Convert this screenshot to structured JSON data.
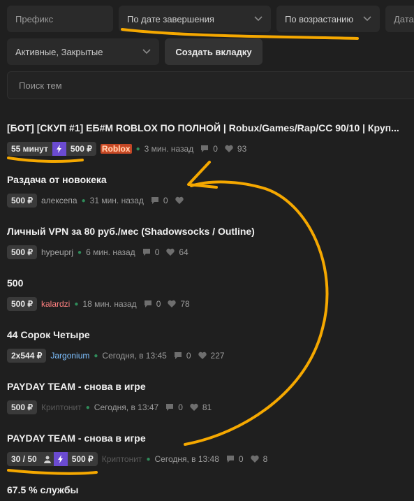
{
  "filters": {
    "prefix_placeholder": "Префикс",
    "sort_by": "По дате завершения",
    "sort_order": "По возрастанию",
    "date_partial": "Дата",
    "status": "Активные, Закрытые",
    "create_tab_label": "Создать вкладку"
  },
  "search": {
    "placeholder": "Поиск тем"
  },
  "threads": [
    {
      "title": "[БОТ] [СКУП #1] ЕБ#М ROBLOX ПО ПОЛНОЙ | Robux/Games/Rap/CC 90/10 | Круп...",
      "chip_time": "55 минут",
      "chip_price": "500 ₽",
      "author": "Roblox",
      "time": "3 мин. назад",
      "replies": "0",
      "likes": "93"
    },
    {
      "title": "Раздача от новокека",
      "chip_price": "500 ₽",
      "author": "алексепа",
      "time": "31 мин. назад",
      "replies": "0",
      "likes": ""
    },
    {
      "title": "Личный VPN за 80 руб./мес (Shadowsocks / Outline)",
      "chip_price": "500 ₽",
      "author": "hypeuprj",
      "time": "6 мин. назад",
      "replies": "0",
      "likes": "64"
    },
    {
      "title": "500",
      "chip_price": "500 ₽",
      "author": "kalardzi",
      "time": "18 мин. назад",
      "replies": "0",
      "likes": "78"
    },
    {
      "title": "44 Сорок Четыре",
      "chip_price": "2x544 ₽",
      "author": "Jargonium",
      "time": "Сегодня, в 13:45",
      "replies": "0",
      "likes": "227"
    },
    {
      "title": "PAYDAY TEAM - снова в игре",
      "chip_price": "500 ₽",
      "author": "Криптонит",
      "time": "Сегодня, в 13:47",
      "replies": "0",
      "likes": "81"
    },
    {
      "title": "PAYDAY TEAM - снова в игре",
      "chip_slots": "30 / 50",
      "chip_price": "500 ₽",
      "author": "Криптонит",
      "time": "Сегодня, в 13:48",
      "replies": "0",
      "likes": "8"
    },
    {
      "title": "67.5 % службы"
    }
  ],
  "colors": {
    "background": "#1f1f1f",
    "panel": "#2a2a2a",
    "bolt_purple": "#6b4bd1",
    "annotation_orange": "#f5a800"
  }
}
